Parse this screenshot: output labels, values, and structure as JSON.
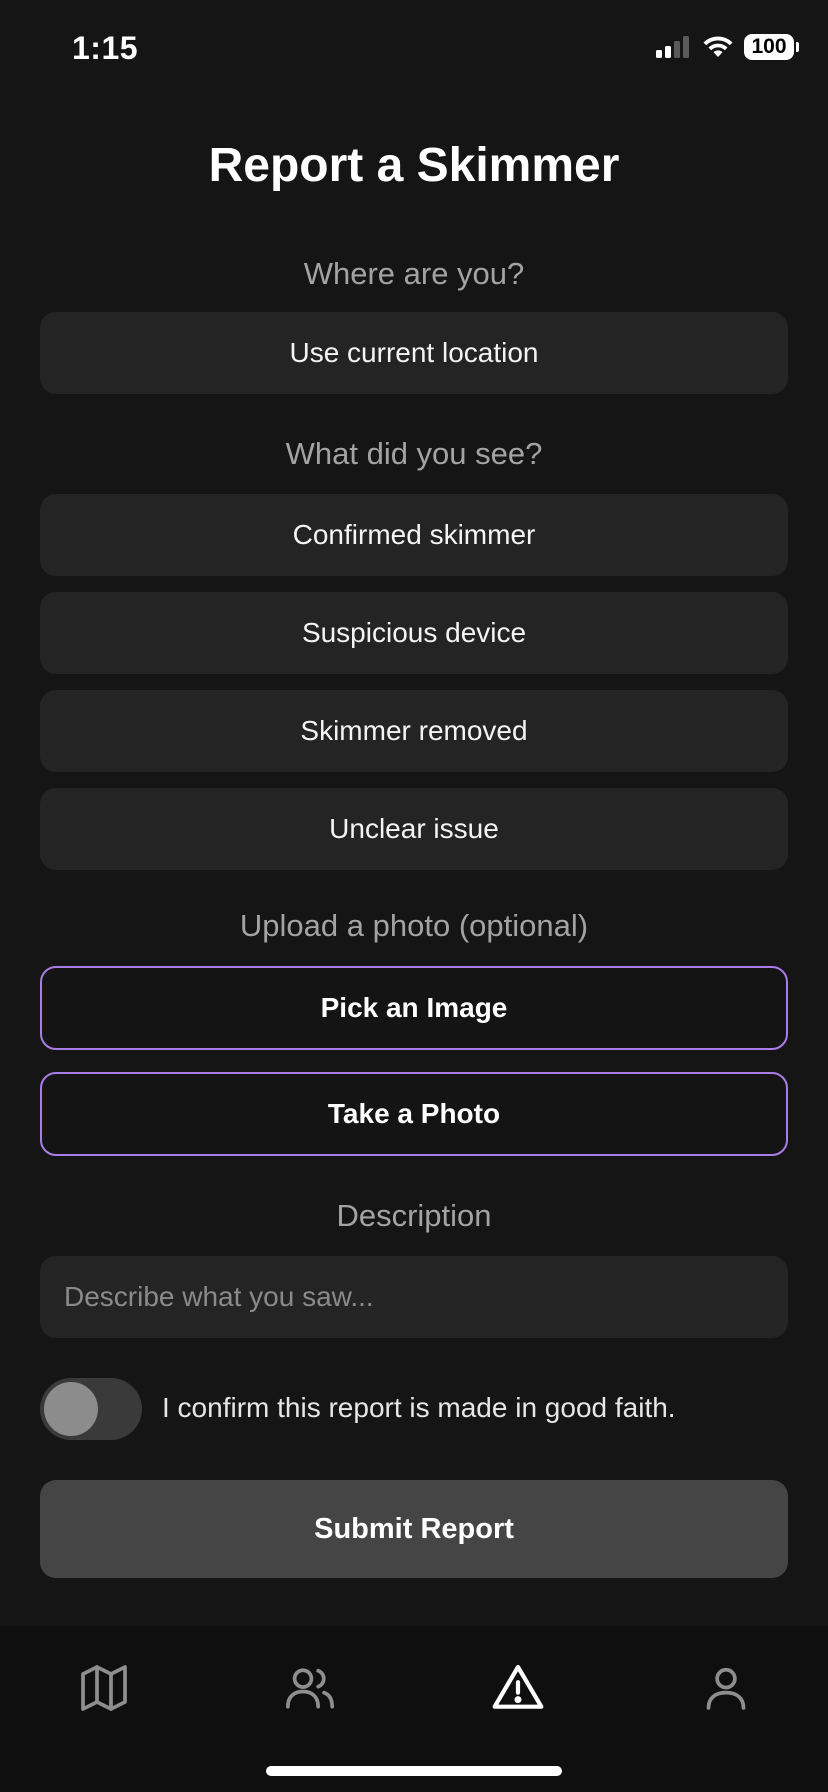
{
  "status_bar": {
    "time": "1:15",
    "battery": "100"
  },
  "page": {
    "title": "Report a Skimmer"
  },
  "location": {
    "label": "Where are you?",
    "button": "Use current location"
  },
  "observation": {
    "label": "What did you see?",
    "options": [
      "Confirmed skimmer",
      "Suspicious device",
      "Skimmer removed",
      "Unclear issue"
    ]
  },
  "photo": {
    "label": "Upload a photo (optional)",
    "pick_image": "Pick an Image",
    "take_photo": "Take a Photo"
  },
  "description": {
    "label": "Description",
    "placeholder": "Describe what you saw...",
    "value": ""
  },
  "confirm": {
    "label": "I confirm this report is made in good faith.",
    "checked": false
  },
  "submit": {
    "label": "Submit Report"
  },
  "tab_bar": {
    "tabs": [
      {
        "icon": "map-icon",
        "active": false
      },
      {
        "icon": "users-icon",
        "active": false
      },
      {
        "icon": "alert-triangle-icon",
        "active": true
      },
      {
        "icon": "user-icon",
        "active": false
      }
    ]
  },
  "colors": {
    "background": "#151515",
    "surface": "#242424",
    "accent": "#a97ce8",
    "muted_text": "#a3a3a3",
    "submit_bg": "#454545",
    "icon_inactive": "#8e8e8e",
    "icon_active": "#ffffff"
  }
}
